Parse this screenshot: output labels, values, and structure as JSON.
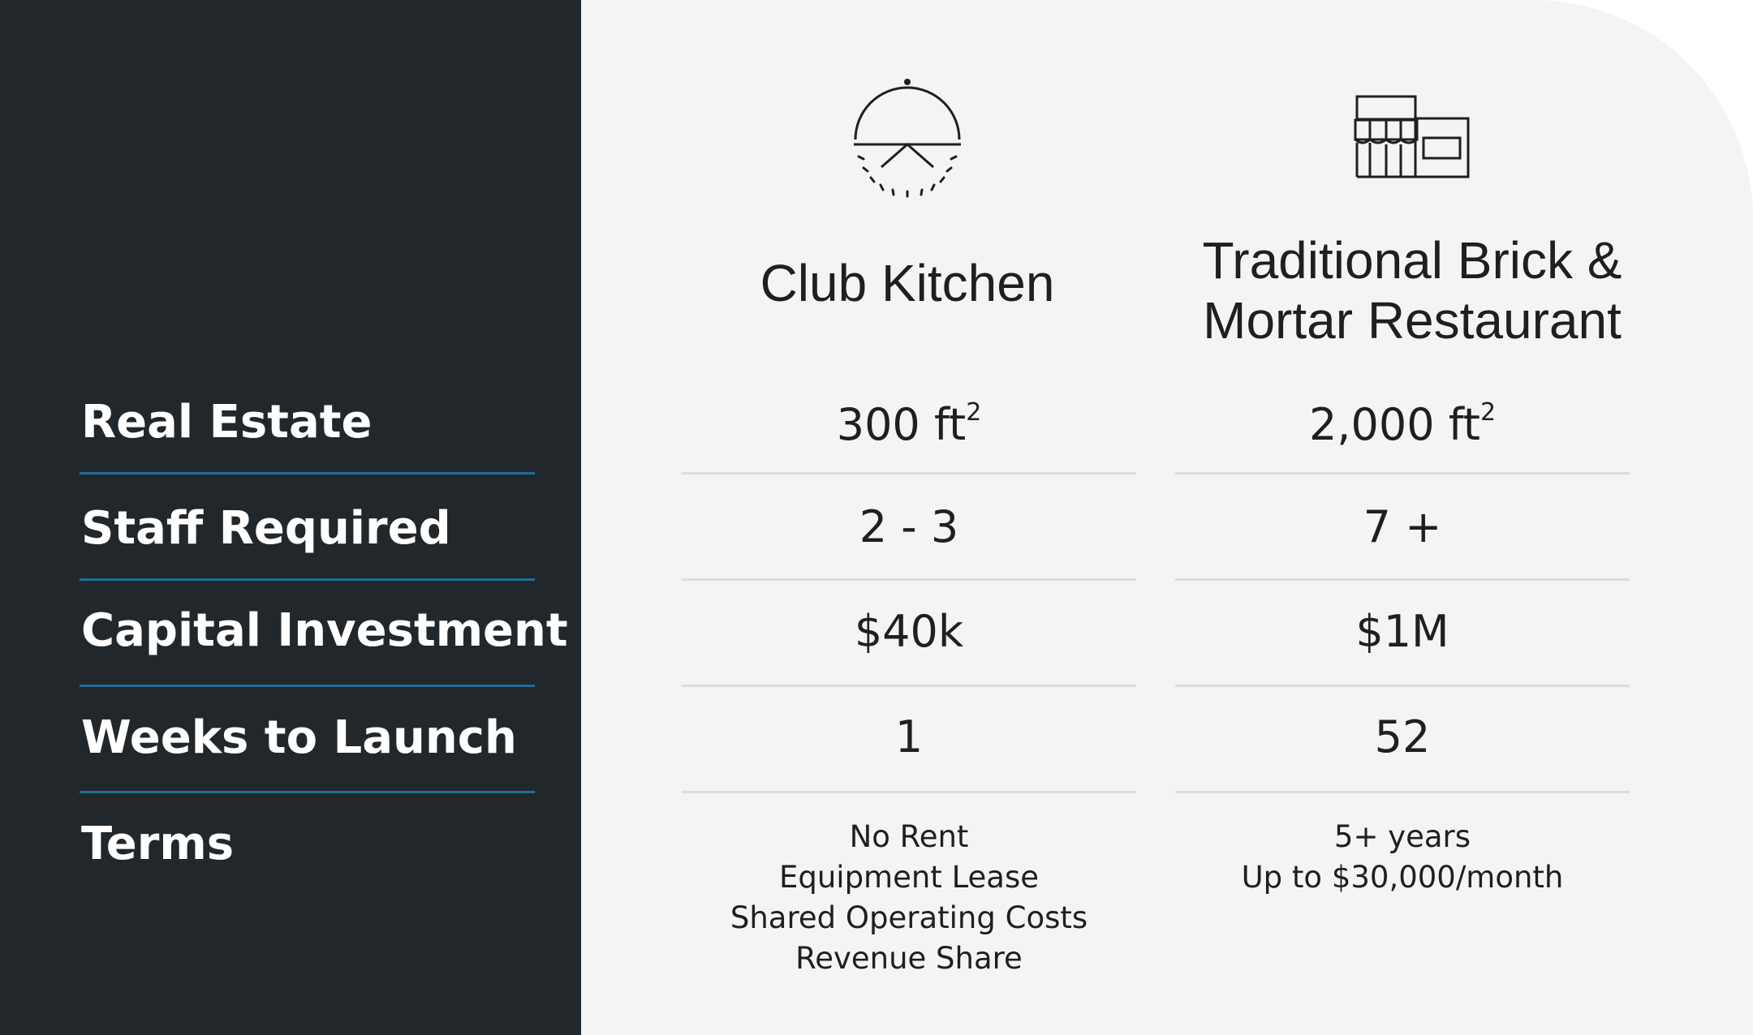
{
  "rows": [
    {
      "label": "Real Estate"
    },
    {
      "label": "Staff Required"
    },
    {
      "label": "Capital Investment"
    },
    {
      "label": "Weeks to Launch"
    },
    {
      "label": "Terms"
    }
  ],
  "columns": [
    {
      "title_line1": "Club Kitchen",
      "icon": "cloche-icon",
      "real_estate_value": "300 ft",
      "real_estate_unit_sup": "2",
      "staff": "2 - 3",
      "capital": "$40k",
      "weeks": "1",
      "terms": [
        "No Rent",
        "Equipment Lease",
        "Shared Operating Costs",
        "Revenue Share"
      ]
    },
    {
      "title_line1": "Traditional Brick &",
      "title_line2": "Mortar Restaurant",
      "icon": "storefront-icon",
      "real_estate_value": "2,000 ft",
      "real_estate_unit_sup": "2",
      "staff": "7 +",
      "capital": "$1M",
      "weeks": "52",
      "terms": [
        "5+ years",
        "Up to $30,000/month"
      ]
    }
  ],
  "colors": {
    "sidebar_bg": "#22272b",
    "panel_bg": "#f3f4f3",
    "accent_rule": "#1f6f9a"
  }
}
